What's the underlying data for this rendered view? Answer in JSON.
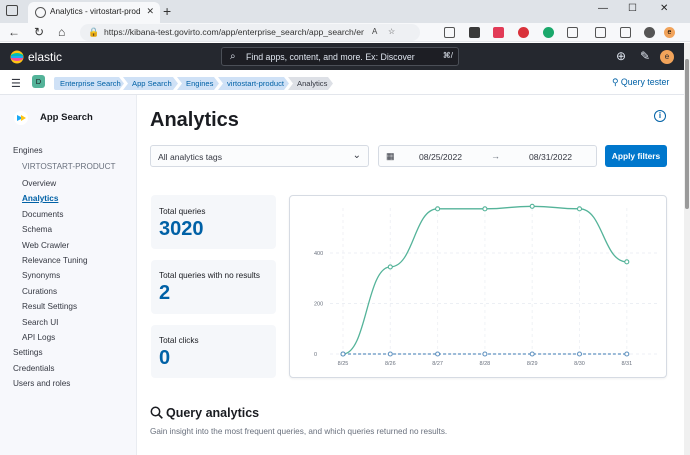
{
  "browser": {
    "tab_title": "Analytics - virtostart-product - E",
    "url": "https://kibana-test.govirto.com/app/enterprise_search/app_search/engines/virtost...",
    "profile_initial": "e"
  },
  "header": {
    "brand": "elastic",
    "search_placeholder": "Find apps, content, and more. Ex: Discover",
    "search_shortcut": "⌘/",
    "avatar_initial": "e"
  },
  "breadcrumbs": {
    "space_badge": "D",
    "items": [
      {
        "label": "Enterprise Search"
      },
      {
        "label": "App Search"
      },
      {
        "label": "Engines"
      },
      {
        "label": "virtostart-product"
      },
      {
        "label": "Analytics"
      }
    ],
    "query_tester": "Query tester"
  },
  "sidebar": {
    "title": "App Search",
    "engines_label": "Engines",
    "engine_name": "VIRTOSTART-PRODUCT",
    "items": [
      {
        "label": "Overview"
      },
      {
        "label": "Analytics"
      },
      {
        "label": "Documents"
      },
      {
        "label": "Schema"
      },
      {
        "label": "Web Crawler"
      },
      {
        "label": "Relevance Tuning"
      },
      {
        "label": "Synonyms"
      },
      {
        "label": "Curations"
      },
      {
        "label": "Result Settings"
      },
      {
        "label": "Search UI"
      },
      {
        "label": "API Logs"
      }
    ],
    "bottom": [
      {
        "label": "Settings"
      },
      {
        "label": "Credentials"
      },
      {
        "label": "Users and roles"
      }
    ]
  },
  "main": {
    "title": "Analytics",
    "tags_select": "All analytics tags",
    "date_start": "08/25/2022",
    "date_end": "08/31/2022",
    "apply_label": "Apply filters",
    "stats": [
      {
        "label": "Total queries",
        "value": "3020"
      },
      {
        "label": "Total queries with no results",
        "value": "2"
      },
      {
        "label": "Total clicks",
        "value": "0"
      }
    ],
    "query_analytics_title": "Query analytics",
    "query_analytics_desc": "Gain insight into the most frequent queries, and which queries returned no results."
  },
  "chart_data": {
    "type": "line",
    "categories": [
      "8/25",
      "8/26",
      "8/27",
      "8/28",
      "8/29",
      "8/30",
      "8/31"
    ],
    "yticks": [
      0,
      200,
      400
    ],
    "ylim": [
      0,
      590
    ],
    "series": [
      {
        "values": [
          0,
          345,
          575,
          575,
          585,
          575,
          365
        ],
        "color": "#54b399"
      },
      {
        "values": [
          0,
          0,
          0,
          0,
          0,
          0,
          0
        ],
        "color": "#6092c0",
        "dashed": true
      }
    ]
  }
}
